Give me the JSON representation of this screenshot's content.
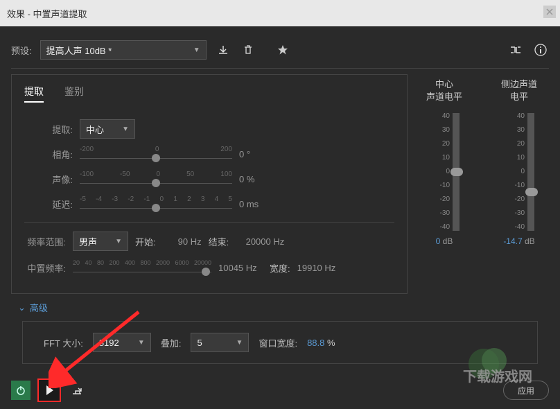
{
  "window_title": "效果 - 中置声道提取",
  "preset_label": "预设:",
  "preset_value": "提高人声 10dB *",
  "tabs": {
    "extract": "提取",
    "identify": "鉴别"
  },
  "extract": {
    "label": "提取:",
    "value": "中心",
    "phase_label": "相角:",
    "phase_ticks": [
      "-200",
      "0",
      "200"
    ],
    "phase_val": "0 °",
    "image_label": "声像:",
    "image_ticks": [
      "-100",
      "-50",
      "0",
      "50",
      "100"
    ],
    "image_val": "0 %",
    "delay_label": "延迟:",
    "delay_ticks": [
      "-5",
      "-4",
      "-3",
      "-2",
      "-1",
      "0",
      "1",
      "2",
      "3",
      "4",
      "5"
    ],
    "delay_val": "0 ms",
    "freq_range_label": "频率范围:",
    "freq_range_value": "男声",
    "start_label": "开始:",
    "start_val": "90 Hz",
    "end_label": "结束:",
    "end_val": "20000 Hz",
    "center_freq_label": "中置频率:",
    "center_ticks": [
      "20",
      "40",
      "80",
      "200",
      "400",
      "800",
      "2000",
      "6000",
      "20000"
    ],
    "center_val": "10045 Hz",
    "width_label": "宽度:",
    "width_val": "19910 Hz"
  },
  "meters": {
    "center_title_l1": "中心",
    "center_title_l2": "声道电平",
    "side_title_l1": "侧边声道",
    "side_title_l2": "电平",
    "scale": [
      "40",
      "30",
      "20",
      "10",
      "0",
      "-10",
      "-20",
      "-30",
      "-40"
    ],
    "center_val": "0",
    "center_unit": " dB",
    "side_val": "-14.7",
    "side_unit": " dB"
  },
  "advanced_label": "高级",
  "adv": {
    "fft_label": "FFT 大小:",
    "fft_val": "8192",
    "overlap_label": "叠加:",
    "overlap_val": "5",
    "winwidth_label": "窗口宽度:",
    "winwidth_val": "88.8",
    "winwidth_unit": " %"
  },
  "apply_label": "应用",
  "watermark_text": "下载游戏网"
}
